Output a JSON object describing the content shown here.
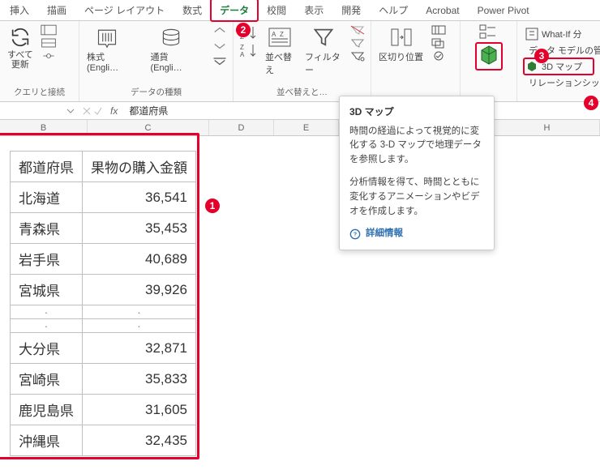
{
  "tabs": {
    "items": [
      {
        "label": "挿入"
      },
      {
        "label": "描画"
      },
      {
        "label": "ページ レイアウト"
      },
      {
        "label": "数式"
      },
      {
        "label": "データ",
        "active": true,
        "hl": true
      },
      {
        "label": "校閲"
      },
      {
        "label": "表示"
      },
      {
        "label": "開発"
      },
      {
        "label": "ヘルプ"
      },
      {
        "label": "Acrobat"
      },
      {
        "label": "Power Pivot"
      }
    ]
  },
  "ribbon": {
    "queries": {
      "refresh": "すべて\n更新",
      "group": "クエリと接続"
    },
    "datatypes": {
      "stocks": "株式 (Engli…",
      "currency": "通貨 (Engli…",
      "group": "データの種類"
    },
    "sort": {
      "sort": "並べ替え",
      "filter": "フィルター",
      "group": "並べ替えと…"
    },
    "datatools": {
      "tc": "区切り位置"
    },
    "rightTools": {
      "whatif": "What-If 分",
      "model": "データ モデルの管",
      "map3d": "3D マップ",
      "relation": "リレーションシップ("
    }
  },
  "fbar": {
    "name": "",
    "fval": "都道府県"
  },
  "cols": {
    "B": "B",
    "C": "C",
    "D": "D",
    "E": "E",
    "H": "H"
  },
  "table": {
    "h1": "都道府県",
    "h2": "果物の購入金額",
    "rows1": [
      {
        "p": "北海道",
        "v": "36,541"
      },
      {
        "p": "青森県",
        "v": "35,453"
      },
      {
        "p": "岩手県",
        "v": "40,689"
      },
      {
        "p": "宮城県",
        "v": "39,926"
      }
    ],
    "rows2": [
      {
        "p": "大分県",
        "v": "32,871"
      },
      {
        "p": "宮崎県",
        "v": "35,833"
      },
      {
        "p": "鹿児島県",
        "v": "31,605"
      },
      {
        "p": "沖縄県",
        "v": "32,435"
      }
    ]
  },
  "tooltip": {
    "title": "3D マップ",
    "p1": "時間の経過によって視覚的に変化する 3-D マップで地理データを参照します。",
    "p2": "分析情報を得て、時間とともに変化するアニメーションやビデオを作成します。",
    "link": "詳細情報"
  },
  "circ": {
    "c1": "1",
    "c2": "2",
    "c3": "3",
    "c4": "4"
  }
}
